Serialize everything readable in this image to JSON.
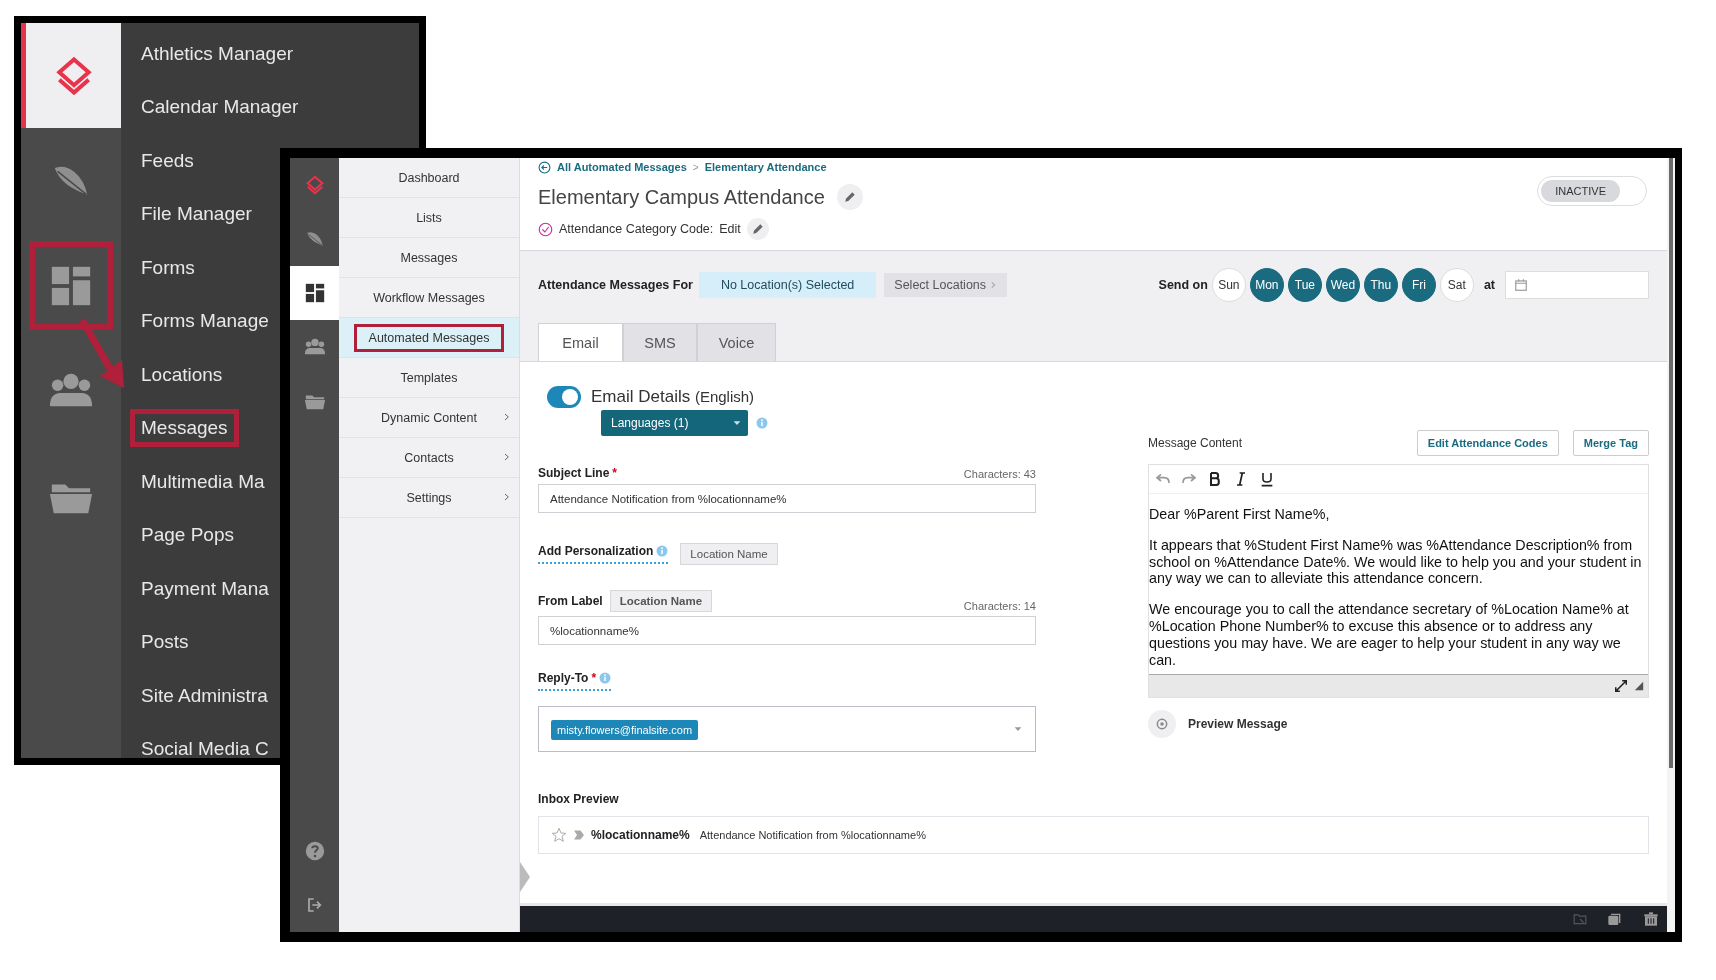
{
  "back_window": {
    "rail": [
      {
        "kind": "logo",
        "selected": true,
        "callout": false
      },
      {
        "kind": "feather",
        "selected": false,
        "callout": false
      },
      {
        "kind": "dashboard",
        "selected": false,
        "callout": true
      },
      {
        "kind": "people",
        "selected": false,
        "callout": false
      },
      {
        "kind": "folder",
        "selected": false,
        "callout": false
      }
    ],
    "menu": [
      {
        "label": "Athletics Manager",
        "callout": false
      },
      {
        "label": "Calendar Manager",
        "callout": false
      },
      {
        "label": "Feeds",
        "callout": false
      },
      {
        "label": "File Manager",
        "callout": false
      },
      {
        "label": "Forms",
        "callout": false
      },
      {
        "label": "Forms Manage",
        "callout": false
      },
      {
        "label": "Locations",
        "callout": false
      },
      {
        "label": "Messages",
        "callout": true
      },
      {
        "label": "Multimedia Ma",
        "callout": false
      },
      {
        "label": "Page Pops",
        "callout": false
      },
      {
        "label": "Payment Mana",
        "callout": false
      },
      {
        "label": "Posts",
        "callout": false
      },
      {
        "label": "Site Administra",
        "callout": false
      },
      {
        "label": "Social Media C",
        "callout": false
      }
    ]
  },
  "front_window": {
    "rail": [
      {
        "kind": "logo",
        "selected": false
      },
      {
        "kind": "feather",
        "selected": false
      },
      {
        "kind": "dashboard",
        "selected": true
      },
      {
        "kind": "people",
        "selected": false
      },
      {
        "kind": "folder",
        "selected": false
      }
    ],
    "nav": [
      {
        "label": "Dashboard",
        "selected": false,
        "has_children": false,
        "callout": false
      },
      {
        "label": "Lists",
        "selected": false,
        "has_children": false,
        "callout": false
      },
      {
        "label": "Messages",
        "selected": false,
        "has_children": false,
        "callout": false
      },
      {
        "label": "Workflow Messages",
        "selected": false,
        "has_children": false,
        "callout": false
      },
      {
        "label": "Automated Messages",
        "selected": true,
        "has_children": false,
        "callout": true
      },
      {
        "label": "Templates",
        "selected": false,
        "has_children": false,
        "callout": false
      },
      {
        "label": "Dynamic Content",
        "selected": false,
        "has_children": true,
        "callout": false
      },
      {
        "label": "Contacts",
        "selected": false,
        "has_children": true,
        "callout": false
      },
      {
        "label": "Settings",
        "selected": false,
        "has_children": true,
        "callout": false
      }
    ],
    "breadcrumb": {
      "items": [
        "All Automated Messages",
        "Elementary Attendance"
      ],
      "separator": ">"
    },
    "title": "Elementary Campus Attendance",
    "status": {
      "label": "INACTIVE",
      "active": false
    },
    "category_code": {
      "label": "Attendance Category Code:",
      "value": "Edit"
    },
    "locations": {
      "label": "Attendance Messages For",
      "value": "No Location(s) Selected",
      "button": "Select Locations"
    },
    "schedule": {
      "label": "Send on",
      "at_label": "at",
      "days": [
        {
          "label": "Sun",
          "selected": false
        },
        {
          "label": "Mon",
          "selected": true
        },
        {
          "label": "Tue",
          "selected": true
        },
        {
          "label": "Wed",
          "selected": true
        },
        {
          "label": "Thu",
          "selected": true
        },
        {
          "label": "Fri",
          "selected": true
        },
        {
          "label": "Sat",
          "selected": false
        }
      ]
    },
    "tabs": [
      {
        "label": "Email",
        "selected": true
      },
      {
        "label": "SMS",
        "selected": false
      },
      {
        "label": "Voice",
        "selected": false
      }
    ],
    "email_details": {
      "enabled": true,
      "title": "Email Details",
      "language": "(English)",
      "languages_button": "Languages (1)"
    },
    "subject": {
      "label": "Subject Line",
      "required_mark": "*",
      "counter": "Characters: 43",
      "value": "Attendance Notification from %locationname%"
    },
    "personalization": {
      "label": "Add Personalization",
      "tag": "Location Name"
    },
    "from_label": {
      "label": "From Label",
      "tag": "Location Name",
      "counter": "Characters: 14",
      "value": "%locationname%"
    },
    "reply_to": {
      "label": "Reply-To",
      "required_mark": "*",
      "tokens": [
        "misty.flowers@finalsite.com"
      ]
    },
    "message": {
      "label": "Message Content",
      "buttons": [
        "Edit Attendance Codes",
        "Merge Tag"
      ],
      "paragraphs": [
        "Dear %Parent First Name%,",
        "It appears that %Student First Name% was %Attendance Description% from school on %Attendance Date%.  We would like to help you and your student in any way we can to alleviate this attendance concern.",
        "We encourage you to call the attendance secretary of %Location Name% at %Location Phone Number% to excuse this absence or to address any questions you may have.  We are eager to help your student in any way we can."
      ],
      "preview": "Preview Message"
    },
    "inbox_preview": {
      "label": "Inbox Preview",
      "sender": "%locationname%",
      "subject": "Attendance Notification from %locationname%"
    }
  }
}
